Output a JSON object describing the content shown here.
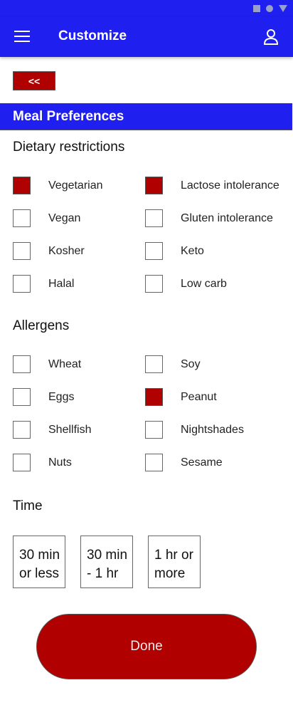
{
  "app_bar": {
    "title": "Customize",
    "menu_icon": "menu-icon",
    "profile_icon": "account-icon"
  },
  "back_button": {
    "label": "<<"
  },
  "section": {
    "title": "Meal Preferences"
  },
  "dietary": {
    "title": "Dietary restrictions",
    "options": [
      {
        "label": "Vegetarian",
        "checked": true
      },
      {
        "label": "Lactose intolerance",
        "checked": true
      },
      {
        "label": "Vegan",
        "checked": false
      },
      {
        "label": "Gluten intolerance",
        "checked": false
      },
      {
        "label": "Kosher",
        "checked": false
      },
      {
        "label": "Keto",
        "checked": false
      },
      {
        "label": "Halal",
        "checked": false
      },
      {
        "label": "Low carb",
        "checked": false
      }
    ]
  },
  "allergens": {
    "title": "Allergens",
    "options": [
      {
        "label": "Wheat",
        "checked": false
      },
      {
        "label": "Soy",
        "checked": false
      },
      {
        "label": "Eggs",
        "checked": false
      },
      {
        "label": "Peanut",
        "checked": true
      },
      {
        "label": "Shellfish",
        "checked": false
      },
      {
        "label": "Nightshades",
        "checked": false
      },
      {
        "label": "Nuts",
        "checked": false
      },
      {
        "label": "Sesame",
        "checked": false
      }
    ]
  },
  "time": {
    "title": "Time",
    "options": [
      {
        "line1": "30 min",
        "line2": "or less"
      },
      {
        "line1": "30 min",
        "line2": "- 1 hr"
      },
      {
        "line1": "1 hr or",
        "line2": "more"
      }
    ]
  },
  "done_button": {
    "label": "Done"
  },
  "colors": {
    "primary": "#1f1ff0",
    "accent": "#b00000"
  }
}
